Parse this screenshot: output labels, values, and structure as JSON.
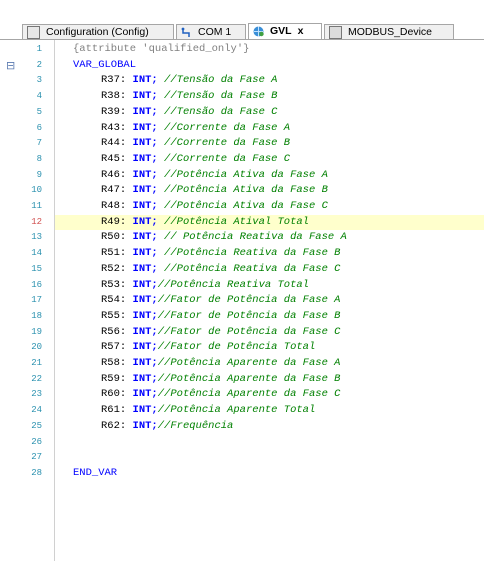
{
  "tabs": [
    {
      "label": "Configuration (Config)",
      "icon": "config-icon"
    },
    {
      "label": "COM 1",
      "icon": "serial-port-icon"
    },
    {
      "label": "GVL",
      "icon": "global-variables-icon",
      "active": true,
      "close": "x"
    },
    {
      "label": "MODBUS_Device",
      "icon": "device-icon"
    }
  ],
  "editor": {
    "current_line": 12,
    "lines": [
      {
        "n": "1",
        "kind": "attr",
        "text": "{attribute 'qualified_only'}"
      },
      {
        "n": "2",
        "kind": "kw",
        "text": "VAR_GLOBAL"
      },
      {
        "n": "3",
        "kind": "decl",
        "name": "R37:",
        "type": "INT;",
        "comment": " //Tensão da Fase A"
      },
      {
        "n": "4",
        "kind": "decl",
        "name": "R38:",
        "type": "INT;",
        "comment": " //Tensão da Fase B"
      },
      {
        "n": "5",
        "kind": "decl",
        "name": "R39:",
        "type": "INT;",
        "comment": " //Tensão da Fase C"
      },
      {
        "n": "6",
        "kind": "decl",
        "name": "R43:",
        "type": "INT;",
        "comment": " //Corrente da Fase A"
      },
      {
        "n": "7",
        "kind": "decl",
        "name": "R44:",
        "type": "INT;",
        "comment": " //Corrente da Fase B"
      },
      {
        "n": "8",
        "kind": "decl",
        "name": "R45:",
        "type": "INT;",
        "comment": " //Corrente da Fase C"
      },
      {
        "n": "9",
        "kind": "decl",
        "name": "R46:",
        "type": "INT;",
        "comment": " //Potência Ativa da Fase A"
      },
      {
        "n": "10",
        "kind": "decl",
        "name": "R47:",
        "type": "INT;",
        "comment": " //Potência Ativa da Fase B"
      },
      {
        "n": "11",
        "kind": "decl",
        "name": "R48:",
        "type": "INT;",
        "comment": " //Potência Ativa da Fase C"
      },
      {
        "n": "12",
        "kind": "decl",
        "name": "R49:",
        "type": "INT;",
        "comment": " //Potência Atival Total"
      },
      {
        "n": "13",
        "kind": "decl",
        "name": "R50:",
        "type": "INT;",
        "comment": " // Potência Reativa da Fase A"
      },
      {
        "n": "14",
        "kind": "decl",
        "name": "R51:",
        "type": "INT;",
        "comment": " //Potência Reativa da Fase B"
      },
      {
        "n": "15",
        "kind": "decl",
        "name": "R52:",
        "type": "INT;",
        "comment": " //Potência Reativa da Fase C"
      },
      {
        "n": "16",
        "kind": "decl",
        "name": "R53:",
        "type": "INT;",
        "comment": "//Potência Reativa Total"
      },
      {
        "n": "17",
        "kind": "decl",
        "name": "R54:",
        "type": "INT;",
        "comment": "//Fator de Potência da Fase A"
      },
      {
        "n": "18",
        "kind": "decl",
        "name": "R55:",
        "type": "INT;",
        "comment": "//Fator de Potência da Fase B"
      },
      {
        "n": "19",
        "kind": "decl",
        "name": "R56:",
        "type": "INT;",
        "comment": "//Fator de Potência da Fase C"
      },
      {
        "n": "20",
        "kind": "decl",
        "name": "R57:",
        "type": "INT;",
        "comment": "//Fator de Potência Total"
      },
      {
        "n": "21",
        "kind": "decl",
        "name": "R58:",
        "type": "INT;",
        "comment": "//Potência Aparente da Fase A"
      },
      {
        "n": "22",
        "kind": "decl",
        "name": "R59:",
        "type": "INT;",
        "comment": "//Potência Aparente da Fase B"
      },
      {
        "n": "23",
        "kind": "decl",
        "name": "R60:",
        "type": "INT;",
        "comment": "//Potência Aparente da Fase C"
      },
      {
        "n": "24",
        "kind": "decl",
        "name": "R61:",
        "type": "INT;",
        "comment": "//Potência Aparente Total"
      },
      {
        "n": "25",
        "kind": "decl",
        "name": "R62:",
        "type": "INT;",
        "comment": "//Frequência"
      },
      {
        "n": "26",
        "kind": "blank",
        "text": ""
      },
      {
        "n": "27",
        "kind": "blank",
        "text": ""
      },
      {
        "n": "28",
        "kind": "kw",
        "text": "END_VAR"
      }
    ]
  },
  "fold_marker": "⊟"
}
